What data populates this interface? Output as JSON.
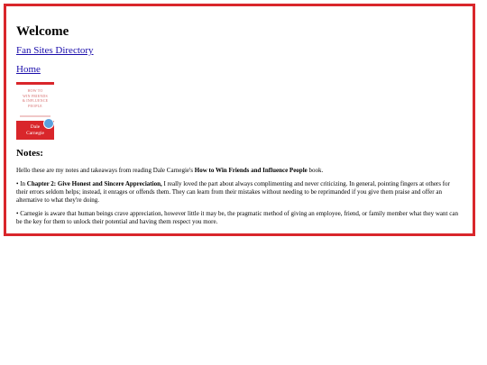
{
  "page": {
    "heading": "Welcome",
    "nav": [
      {
        "label": "Fan Sites Directory"
      },
      {
        "label": "Home"
      }
    ]
  },
  "book_cover": {
    "title_lines": [
      "HOW TO",
      "WIN FRIENDS",
      "& INFLUENCE",
      "PEOPLE"
    ],
    "author_first": "Dale",
    "author_last": "Carnegie"
  },
  "notes": {
    "heading": "Notes:",
    "intro_prefix": "Hello these are my notes and takeaways from reading Dale Carnegie's ",
    "intro_book": "How to Win Friends and Influence People",
    "intro_suffix": " book.",
    "bullet1_prefix": "• In ",
    "bullet1_chapter": "Chapter 2: Give Honest and Sincere Appreciation,",
    "bullet1_text": " I really loved the part about always complimenting and never criticizing. In general, pointing fingers at others for their errors seldom helps; instead, it enrages or offends them. They can learn from their mistakes without needing to be reprimanded if you give them praise and offer an alternative to what they're doing.",
    "bullet2": "• Carnegie is aware that human beings crave appreciation, however little it may be, the pragmatic method of giving an employee, friend, or family member what they want can be the key for them to unlock their potential and having them respect you more."
  },
  "colors": {
    "frame_border": "#d9262b",
    "link": "#1a0dab",
    "cover_red": "#d9262b"
  }
}
